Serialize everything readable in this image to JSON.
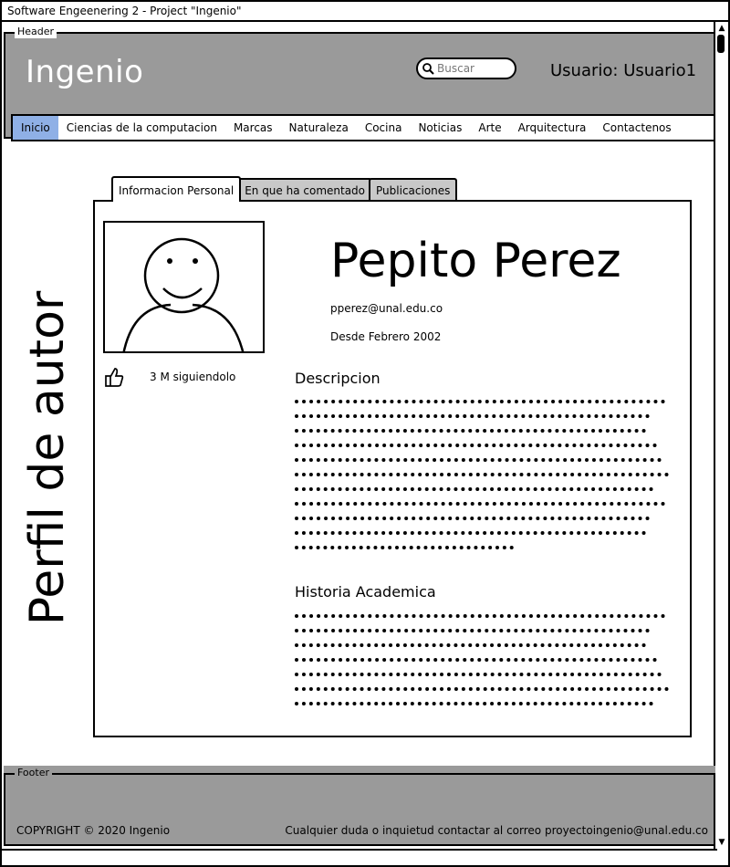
{
  "window": {
    "title": "Software Engeenering 2 - Project  \"Ingenio\""
  },
  "header": {
    "legend": "Header",
    "logo": "Ingenio",
    "search_placeholder": "Buscar",
    "user_label": "Usuario: Usuario1",
    "nav": [
      {
        "label": "Inicio",
        "active": true
      },
      {
        "label": "Ciencias de la computacion",
        "active": false
      },
      {
        "label": "Marcas",
        "active": false
      },
      {
        "label": "Naturaleza",
        "active": false
      },
      {
        "label": "Cocina",
        "active": false
      },
      {
        "label": "Noticias",
        "active": false
      },
      {
        "label": "Arte",
        "active": false
      },
      {
        "label": "Arquitectura",
        "active": false
      },
      {
        "label": "Contactenos",
        "active": false
      }
    ]
  },
  "page": {
    "side_title": "Perfil de autor",
    "tabs": [
      {
        "label": "Informacion Personal",
        "active": true
      },
      {
        "label": "En que ha comentado",
        "active": false
      },
      {
        "label": "Publicaciones",
        "active": false
      }
    ]
  },
  "profile": {
    "name": "Pepito Perez",
    "email": "pperez@unal.edu.co",
    "since": "Desde Febrero 2002",
    "followers": "3 M siguiendolo",
    "description_title": "Descripcion",
    "history_title": "Historia Academica"
  },
  "footer": {
    "legend": "Footer",
    "copyright": "COPYRIGHT © 2020 Ingenio",
    "contact": "Cualquier duda o inquietud contactar al correo proyectoingenio@unal.edu.co"
  },
  "icons": {
    "search": "search-icon",
    "like": "thumbs-up-icon",
    "avatar": "user-avatar-icon"
  },
  "colors": {
    "header_bg": "#9a9a9a",
    "active_nav": "#8fb0e6",
    "inactive_tab": "#c8c8c8"
  }
}
